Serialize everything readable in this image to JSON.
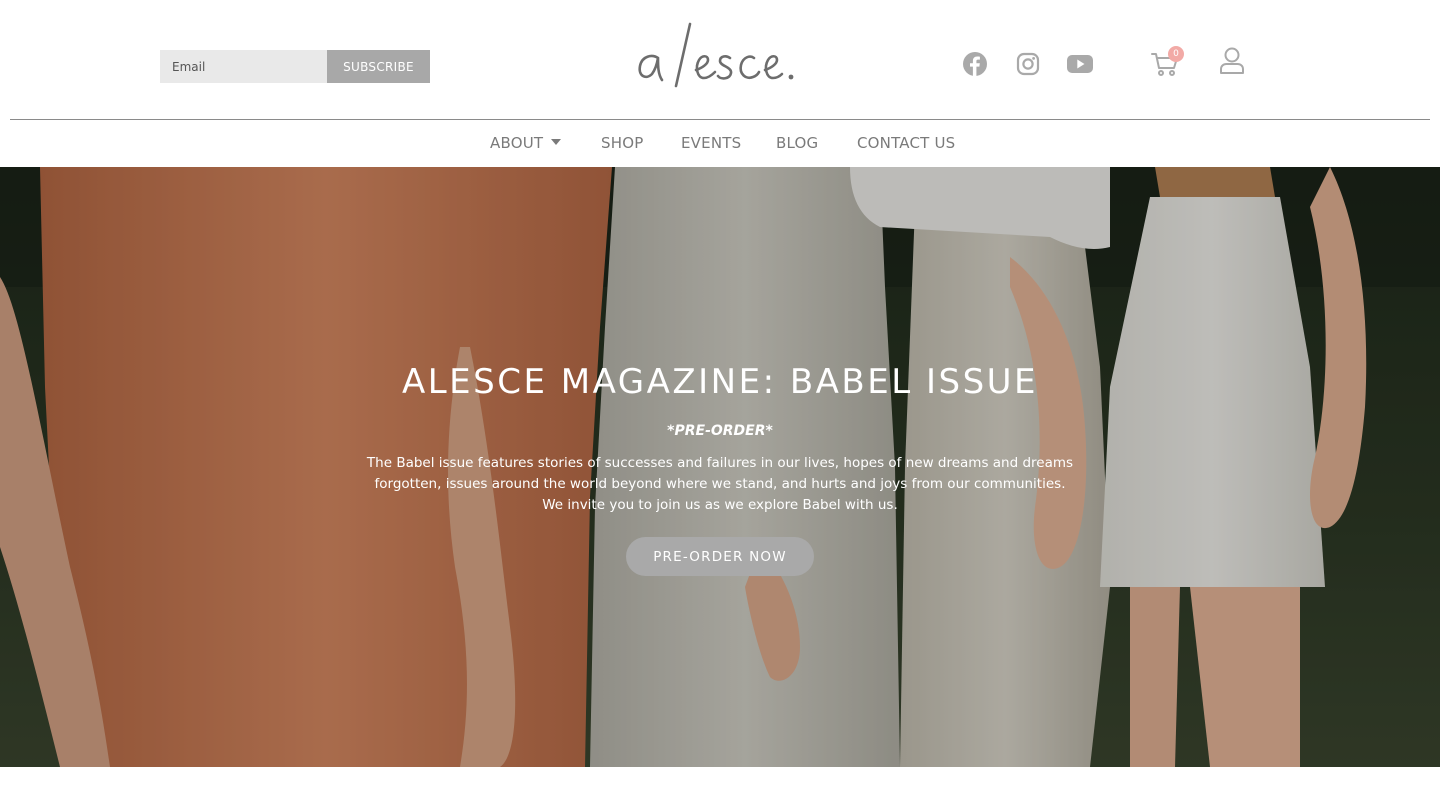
{
  "subscribe": {
    "email_placeholder": "Email",
    "button_label": "SUBSCRIBE"
  },
  "logo": {
    "text": "alesce."
  },
  "social": [
    {
      "name": "facebook-icon"
    },
    {
      "name": "instagram-icon"
    },
    {
      "name": "youtube-icon"
    }
  ],
  "cart": {
    "count": "0"
  },
  "nav": {
    "items": [
      {
        "label": "ABOUT",
        "has_dropdown": true
      },
      {
        "label": "SHOP"
      },
      {
        "label": "EVENTS"
      },
      {
        "label": "BLOG"
      },
      {
        "label": "CONTACT US"
      }
    ]
  },
  "hero": {
    "title": "ALESCE MAGAZINE: BABEL ISSUE",
    "preorder_tag": "*PRE-ORDER*",
    "description_lines": [
      "The Babel issue features stories of successes and failures in our lives, hopes of new dreams and dreams",
      "forgotten, issues around the world beyond where we stand, and hurts and joys from our communities.",
      "We invite you to join us as we explore Babel with us."
    ],
    "button_label": "PRE-ORDER NOW"
  },
  "colors": {
    "icon_gray": "#a9a9a9",
    "nav_text": "#7a7a7a",
    "badge_pink": "#f2aaa6",
    "button_gray": "#a8a8a8"
  }
}
